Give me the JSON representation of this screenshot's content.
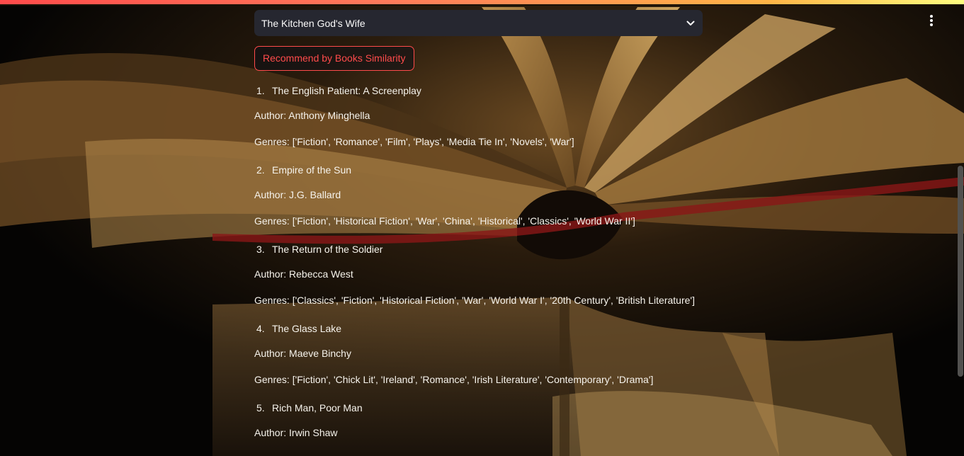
{
  "selector": {
    "selected_book": "The Kitchen God's Wife"
  },
  "recommend_button": "Recommend by Books Similarity",
  "results": [
    {
      "index": "1.",
      "title": "The English Patient: A Screenplay",
      "author": "Author: Anthony Minghella",
      "genres": "Genres: ['Fiction', 'Romance', 'Film', 'Plays', 'Media Tie In', 'Novels', 'War']"
    },
    {
      "index": "2.",
      "title": "Empire of the Sun",
      "author": "Author: J.G. Ballard",
      "genres": "Genres: ['Fiction', 'Historical Fiction', 'War', 'China', 'Historical', 'Classics', 'World War II']"
    },
    {
      "index": "3.",
      "title": "The Return of the Soldier",
      "author": "Author: Rebecca West",
      "genres": "Genres: ['Classics', 'Fiction', 'Historical Fiction', 'War', 'World War I', '20th Century', 'British Literature']"
    },
    {
      "index": "4.",
      "title": "The Glass Lake",
      "author": "Author: Maeve Binchy",
      "genres": "Genres: ['Fiction', 'Chick Lit', 'Ireland', 'Romance', 'Irish Literature', 'Contemporary', 'Drama']"
    },
    {
      "index": "5.",
      "title": "Rich Man, Poor Man",
      "author": "Author: Irwin Shaw",
      "genres": ""
    }
  ],
  "icons": {
    "menu": "vertical-ellipsis-icon",
    "dropdown": "chevron-down-icon"
  },
  "colors": {
    "accent": "#ff4b4b",
    "select_bg": "#262730",
    "text": "#fafafa"
  }
}
